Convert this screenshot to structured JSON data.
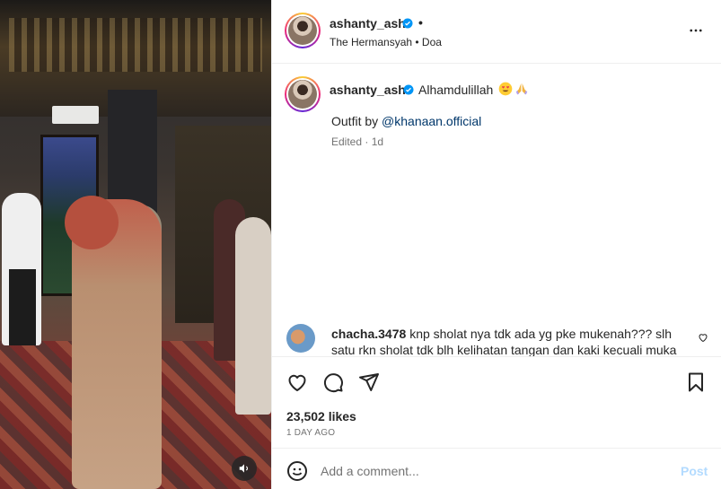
{
  "header": {
    "username": "ashanty_ash",
    "separator": "•",
    "subtitle": "The Hermansyah • Doa"
  },
  "caption": {
    "username": "ashanty_ash",
    "text": "Alhamdulillah",
    "emojis": [
      "heart-eyes-emoji",
      "praying-hands-emoji"
    ],
    "outfit_prefix": "Outfit by",
    "mention": "@khanaan.official",
    "edited": "Edited · 1d"
  },
  "comment": {
    "username": "chacha.3478",
    "text": "knp sholat nya tdk ada yg pke mukenah??? slh satu rkn sholat tdk blh kelihatan tangan dan kaki kecuali muka"
  },
  "stats": {
    "likes": "23,502 likes",
    "time": "1 DAY AGO"
  },
  "composer": {
    "placeholder": "Add a comment...",
    "post_label": "Post"
  },
  "colors": {
    "verified": "#0095f6",
    "link": "#00376b",
    "post_disabled": "#b3dbff",
    "muted_text": "#737373"
  },
  "icons": [
    "volume-muted-icon",
    "more-options-icon",
    "verified-badge-icon",
    "heart-icon",
    "comment-icon",
    "share-icon",
    "bookmark-icon",
    "emoji-icon",
    "comment-like-icon"
  ]
}
